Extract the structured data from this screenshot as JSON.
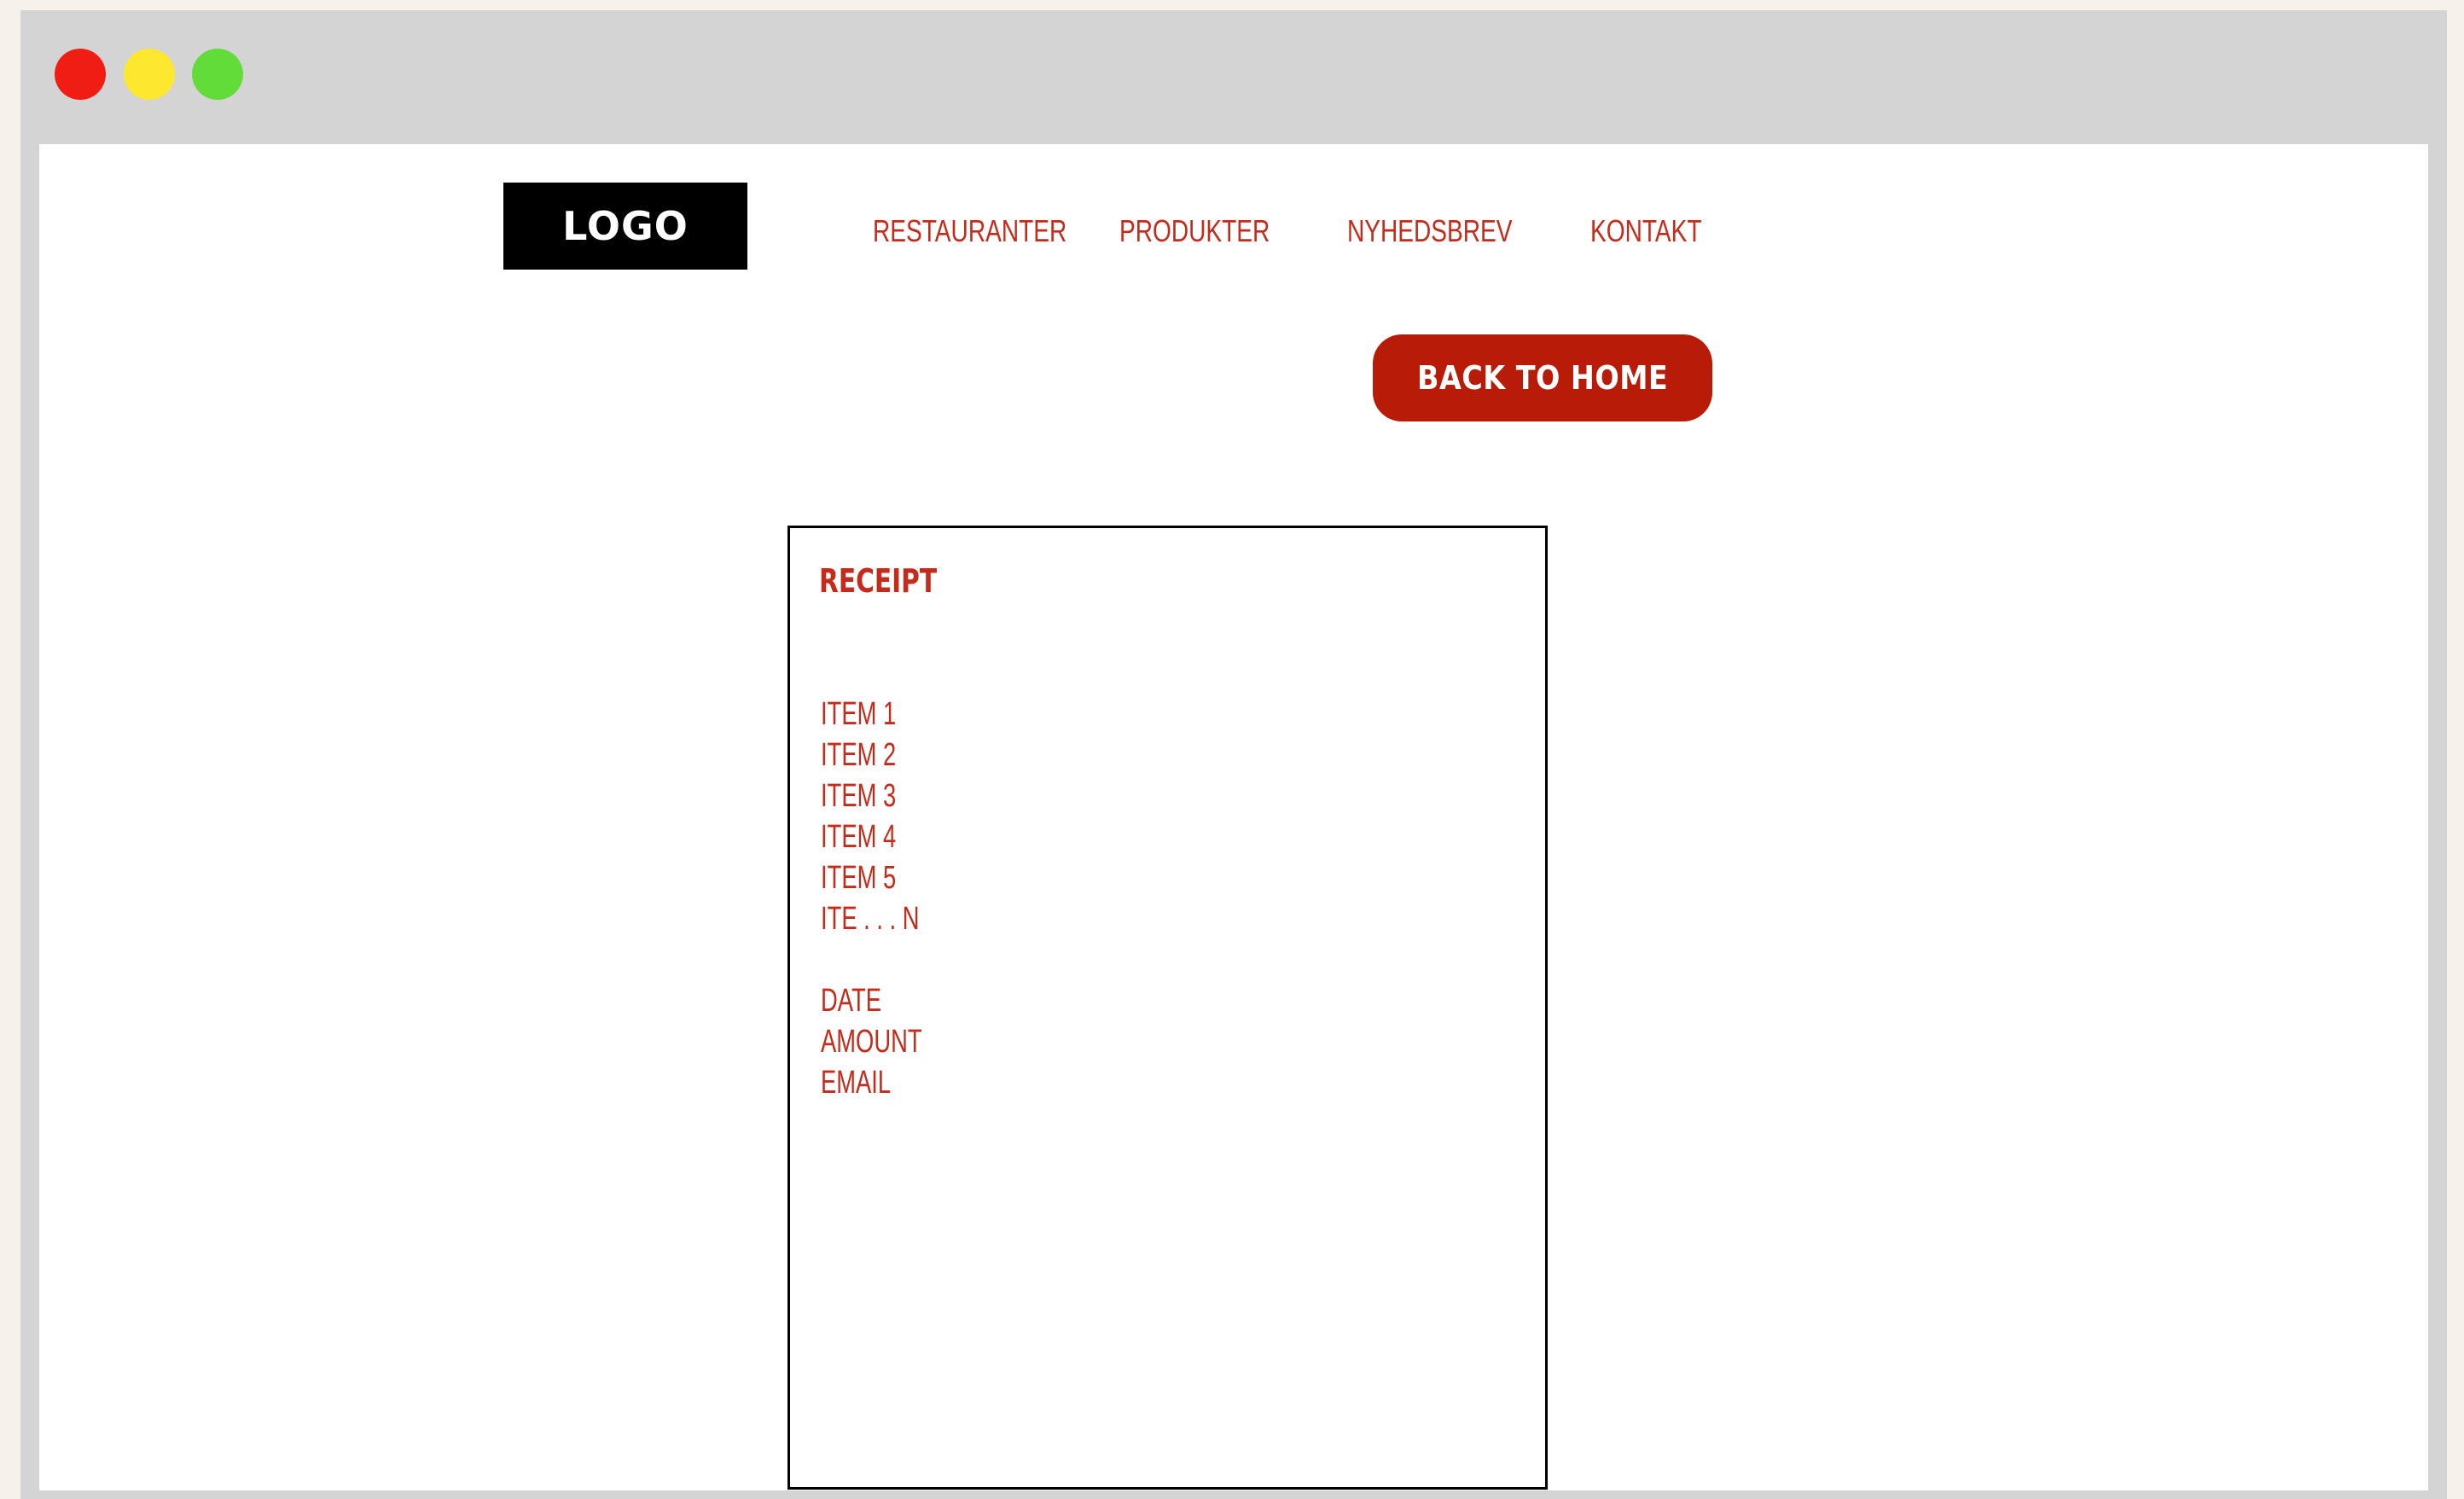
{
  "window": {
    "controls": [
      {
        "name": "close",
        "color": "#f01e12"
      },
      {
        "name": "minimize",
        "color": "#fde82f"
      },
      {
        "name": "maximize",
        "color": "#62dc38"
      }
    ]
  },
  "header": {
    "logo_text": "LOGO",
    "nav": [
      {
        "label": "RESTAURANTER"
      },
      {
        "label": "PRODUKTER"
      },
      {
        "label": "NYHEDSBREV"
      },
      {
        "label": "KONTAKT"
      }
    ]
  },
  "actions": {
    "back_label": "BACK TO HOME"
  },
  "receipt": {
    "title": "RECEIPT",
    "items": [
      "ITEM 1",
      "ITEM 2",
      "ITEM 3",
      "ITEM 4",
      "ITEM 5",
      "ITE . . . N"
    ],
    "fields": [
      "DATE",
      "AMOUNT",
      "EMAIL"
    ]
  },
  "colors": {
    "accent_text": "#c42b1a",
    "button_bg": "#b81c08",
    "logo_bg": "#000000",
    "chrome_bg": "#d4d4d4",
    "page_bg": "#f6f2ea"
  }
}
